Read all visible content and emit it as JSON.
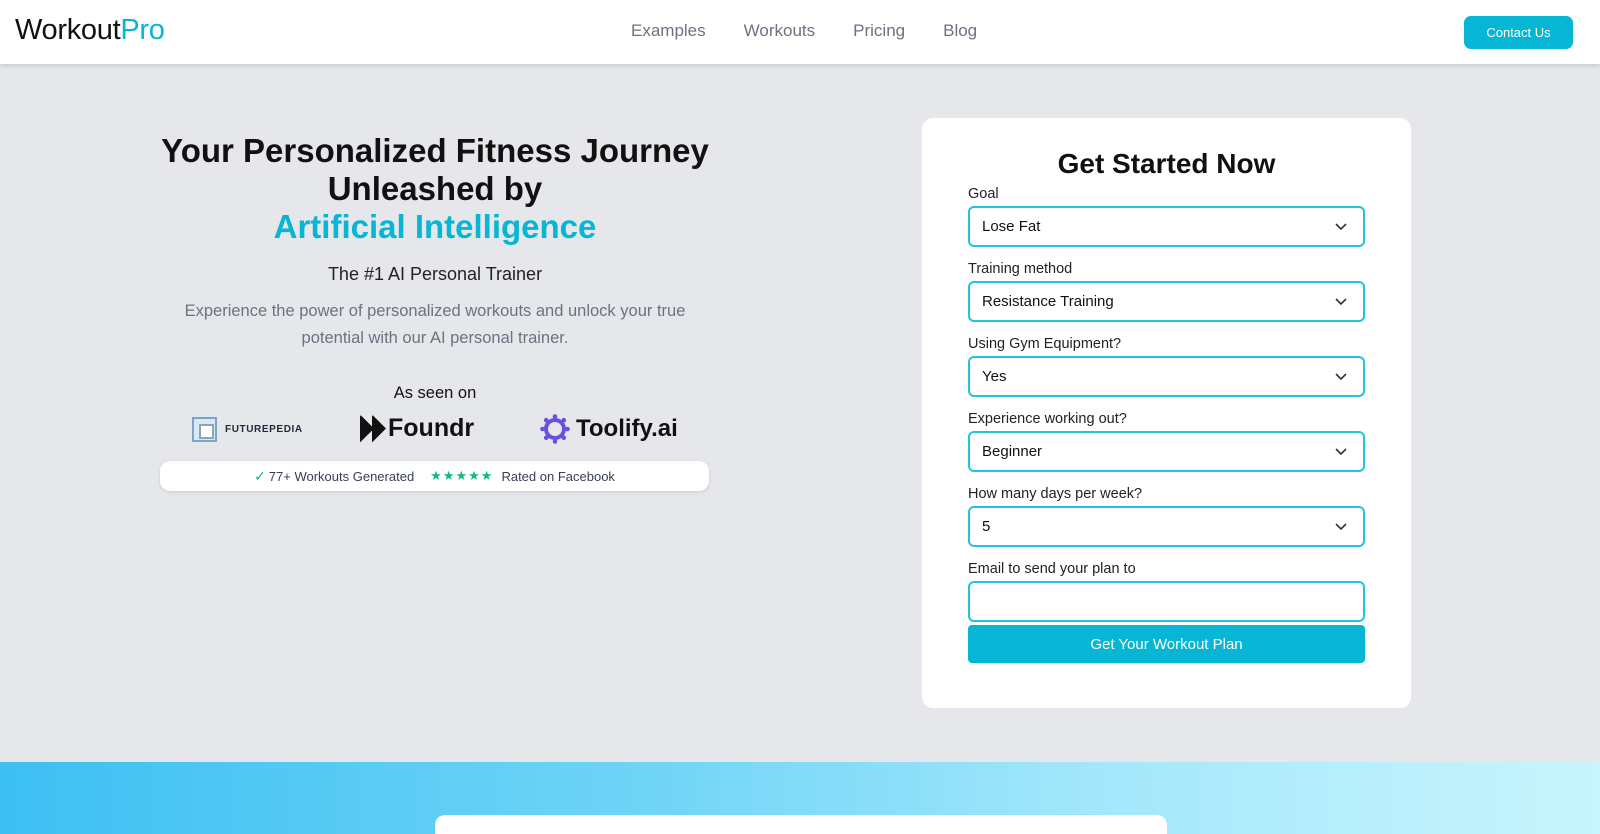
{
  "header": {
    "logo_main": "Workout",
    "logo_accent": "Pro",
    "nav": [
      "Examples",
      "Workouts",
      "Pricing",
      "Blog"
    ],
    "contact_label": "Contact Us"
  },
  "hero": {
    "title_line1": "Your Personalized Fitness Journey",
    "title_line2": "Unleashed by",
    "title_highlight": "Artificial Intelligence",
    "subtitle": "The #1 AI Personal Trainer",
    "description": "Experience the power of personalized workouts and unlock your true potential with our AI personal trainer.",
    "seen_on": "As seen on",
    "logos": {
      "futurepedia": "FUTUREPEDIA",
      "foundr": "Foundr",
      "toolify": "Toolify.ai"
    },
    "rating": {
      "workouts_text": "77+ Workouts Generated",
      "stars": 5,
      "rated_text": "Rated on Facebook"
    }
  },
  "form": {
    "title": "Get Started Now",
    "fields": [
      {
        "label": "Goal",
        "value": "Lose Fat"
      },
      {
        "label": "Training method",
        "value": "Resistance Training"
      },
      {
        "label": "Using Gym Equipment?",
        "value": "Yes"
      },
      {
        "label": "Experience working out?",
        "value": "Beginner"
      },
      {
        "label": "How many days per week?",
        "value": "5"
      }
    ],
    "email_label": "Email to send your plan to",
    "email_value": "",
    "submit_label": "Get Your Workout Plan"
  },
  "colors": {
    "accent": "#06b6d4",
    "background": "#e5e7eb",
    "star": "#10b981"
  }
}
